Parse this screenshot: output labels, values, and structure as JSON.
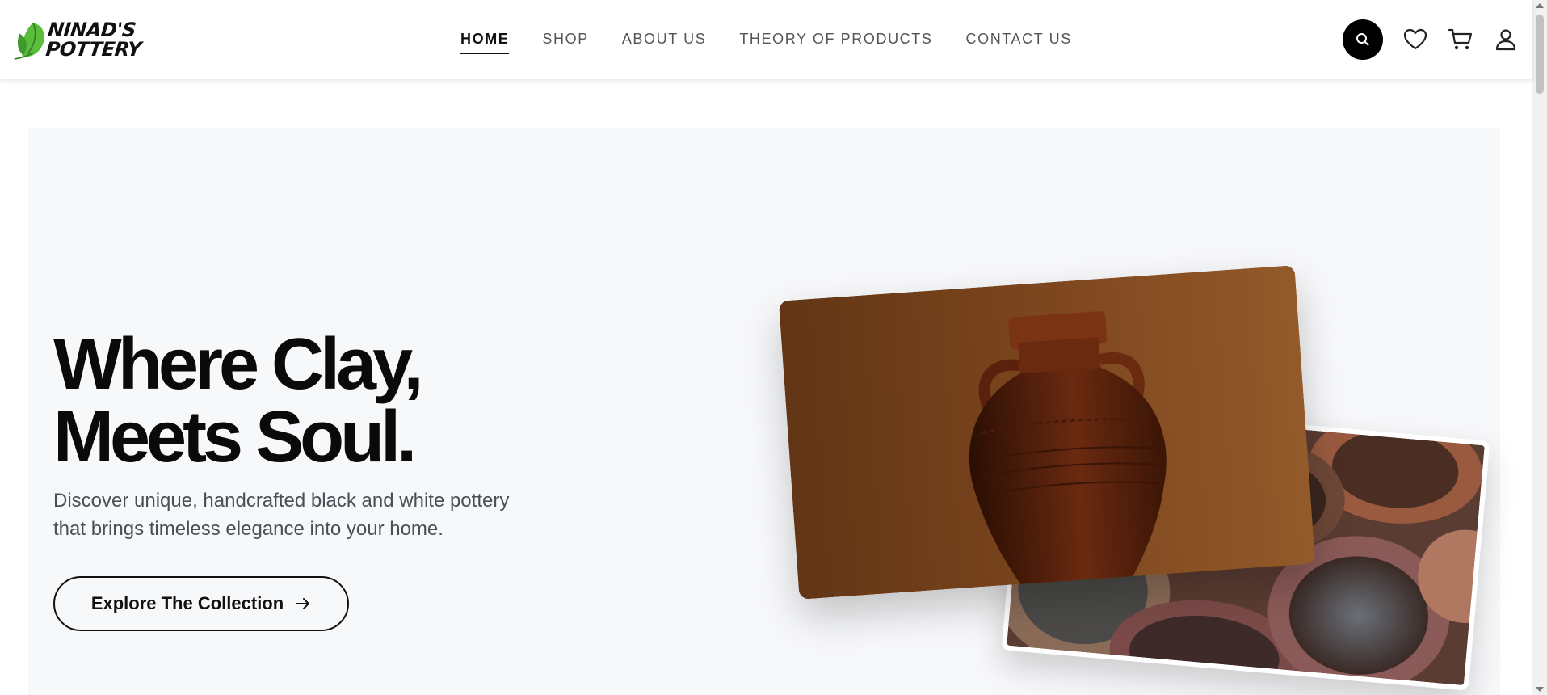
{
  "header": {
    "logo": {
      "line1": "NINAD'S",
      "line2": "POTTERY",
      "icon": "leaf-icon"
    },
    "nav": [
      {
        "label": "HOME",
        "active": true
      },
      {
        "label": "SHOP",
        "active": false
      },
      {
        "label": "ABOUT US",
        "active": false
      },
      {
        "label": "THEORY OF PRODUCTS",
        "active": false
      },
      {
        "label": "CONTACT US",
        "active": false
      }
    ],
    "icons": [
      "search-icon",
      "heart-icon",
      "cart-icon",
      "user-icon"
    ]
  },
  "hero": {
    "title_line1": "Where Clay,",
    "title_line2": "Meets Soul.",
    "subtitle_line1": "Discover unique, handcrafted black and white pottery",
    "subtitle_line2": "that brings timeless elegance into your home.",
    "cta_label": "Explore The Collection",
    "cta_icon": "arrow-right-icon",
    "images": [
      "clay-vase-photo",
      "ceramic-bowls-photo"
    ]
  },
  "colors": {
    "accent": "#000000",
    "hero_bg": "#f7f8fa",
    "text_muted": "#4a4f57",
    "leaf_green": "#4caf3b"
  }
}
